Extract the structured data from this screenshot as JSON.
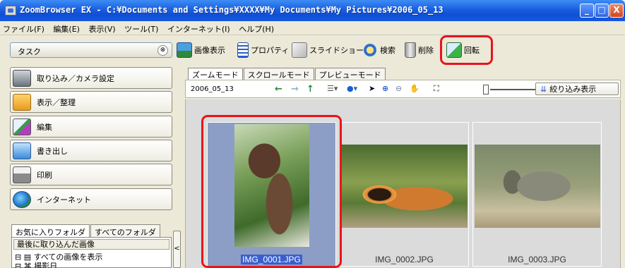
{
  "window": {
    "title": "ZoomBrowser EX  -  C:¥Documents and Settings¥XXXX¥My Documents¥My Pictures¥2006_05_13",
    "minimize": "_",
    "maximize": "□",
    "close": "X"
  },
  "menu": [
    "ファイル(F)",
    "編集(E)",
    "表示(V)",
    "ツール(T)",
    "インターネット(I)",
    "ヘルプ(H)"
  ],
  "task_header": {
    "label": "タスク",
    "chevron": "⊗"
  },
  "toolbar": {
    "view": "画像表示",
    "properties": "プロパティ",
    "slideshow": "スライドショー",
    "search": "検索",
    "delete": "削除",
    "rotate": "回転"
  },
  "nav": [
    {
      "label": "取り込み／カメラ設定"
    },
    {
      "label": "表示／整理"
    },
    {
      "label": "編集"
    },
    {
      "label": "書き出し"
    },
    {
      "label": "印刷"
    },
    {
      "label": "インターネット"
    }
  ],
  "folder_tabs": [
    "お気に入りフォルダ",
    "すべてのフォルダ"
  ],
  "folder_pane": {
    "recent": "最後に取り込んだ画像",
    "tree_item_1": "⊟ ▤ すべての画像を表示",
    "tree_item_2": "⊟ ⌘ 撮影日"
  },
  "splitter": "<",
  "mode_tabs": [
    "ズームモード",
    "スクロールモード",
    "プレビューモード"
  ],
  "path": "2006_05_13",
  "filter_button": "絞り込み表示",
  "thumbnails": [
    {
      "filename": "IMG_0001.JPG",
      "selected": true
    },
    {
      "filename": "IMG_0002.JPG",
      "selected": false
    },
    {
      "filename": "IMG_0003.JPG",
      "selected": false
    }
  ],
  "colors": {
    "highlight": "#e8141b",
    "title_bar": "#1a5fe0",
    "selection": "#3a5fcd"
  }
}
